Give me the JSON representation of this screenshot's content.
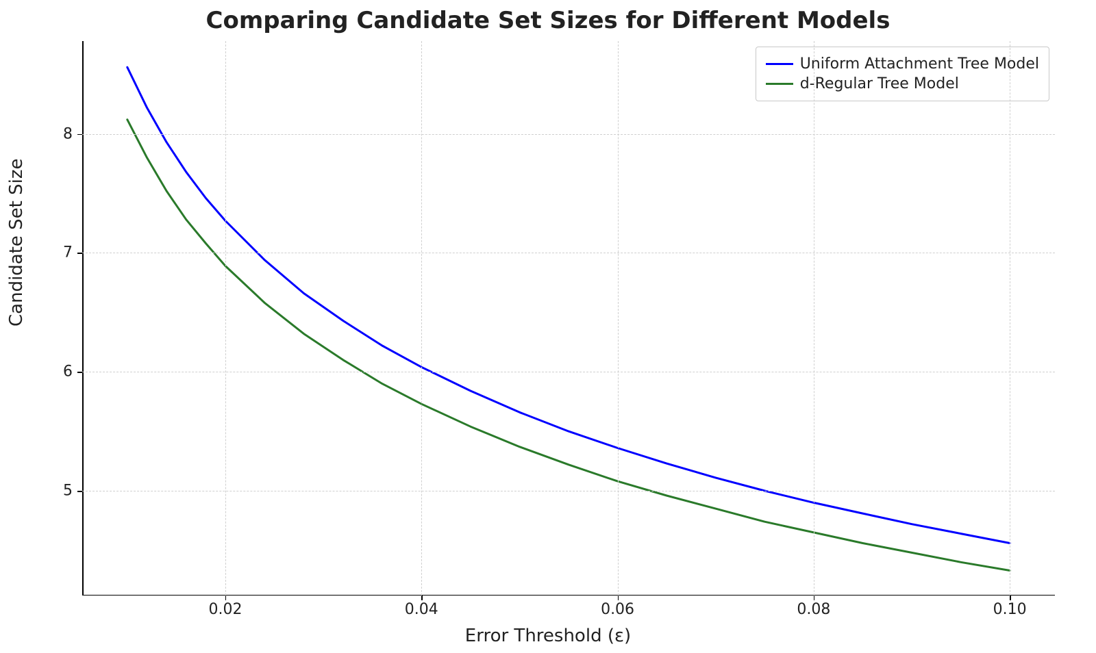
{
  "chart_data": {
    "type": "line",
    "title": "Comparing Candidate Set Sizes for Different Models",
    "xlabel": "Error Threshold (ε)",
    "ylabel": "Candidate Set Size",
    "xlim": [
      0.0054,
      0.1046
    ],
    "ylim": [
      4.12,
      8.78
    ],
    "xticks": [
      0.02,
      0.04,
      0.06,
      0.08,
      0.1
    ],
    "yticks": [
      5,
      6,
      7,
      8
    ],
    "x": [
      0.01,
      0.012,
      0.014,
      0.016,
      0.018,
      0.02,
      0.024,
      0.028,
      0.032,
      0.036,
      0.04,
      0.045,
      0.05,
      0.055,
      0.06,
      0.065,
      0.07,
      0.075,
      0.08,
      0.085,
      0.09,
      0.095,
      0.1
    ],
    "series": [
      {
        "name": "Uniform Attachment Tree Model",
        "color": "#0000ff",
        "values": [
          8.56,
          8.22,
          7.93,
          7.68,
          7.46,
          7.27,
          6.94,
          6.66,
          6.43,
          6.22,
          6.04,
          5.84,
          5.66,
          5.5,
          5.36,
          5.23,
          5.11,
          5.0,
          4.9,
          4.81,
          4.72,
          4.64,
          4.56
        ]
      },
      {
        "name": "d-Regular Tree Model",
        "color": "#2a7a2a",
        "values": [
          8.12,
          7.8,
          7.52,
          7.28,
          7.08,
          6.89,
          6.58,
          6.32,
          6.1,
          5.9,
          5.73,
          5.54,
          5.37,
          5.22,
          5.08,
          4.96,
          4.85,
          4.74,
          4.65,
          4.56,
          4.48,
          4.4,
          4.33
        ]
      }
    ],
    "legend_position": "upper-right",
    "grid": true
  }
}
